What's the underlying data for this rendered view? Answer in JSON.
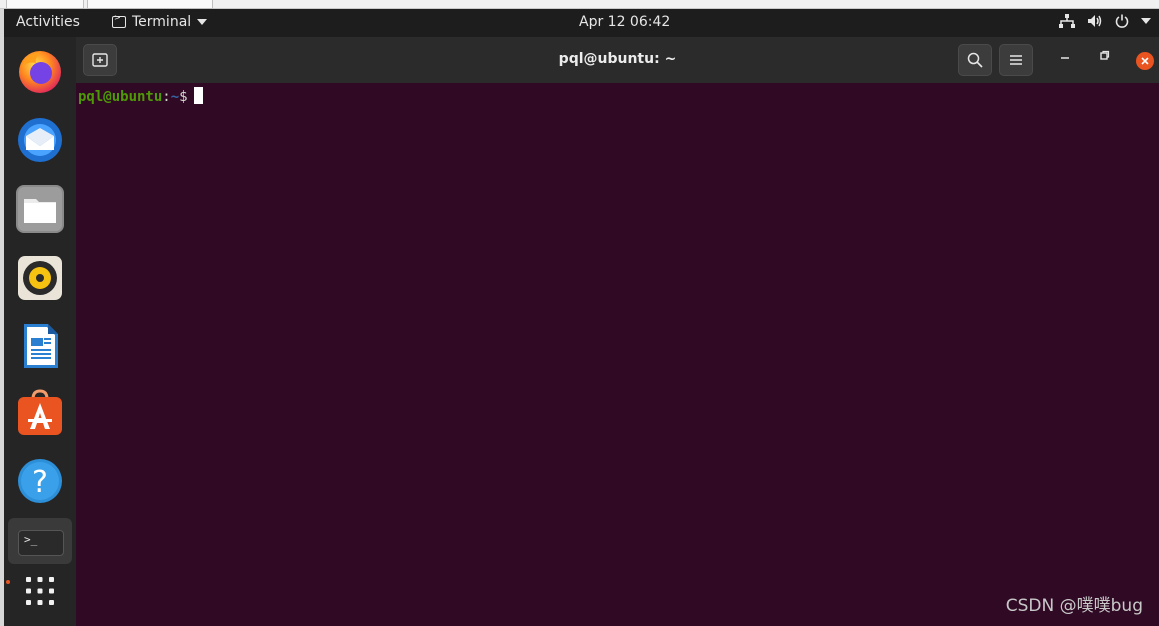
{
  "topbar": {
    "activities": "Activities",
    "app_name": "Terminal",
    "clock": "Apr 12  06:42",
    "tray_icons": [
      "network-icon",
      "volume-icon",
      "power-icon",
      "chevron-down-icon"
    ]
  },
  "dock": {
    "items": [
      "firefox",
      "thunderbird",
      "files",
      "rhythmbox",
      "libreoffice-writer",
      "ubuntu-software",
      "help",
      "terminal",
      "show-applications"
    ],
    "active_item": "terminal",
    "terminal_glyph": ">_"
  },
  "terminal": {
    "title": "pql@ubuntu: ~",
    "prompt_user": "pql@ubuntu",
    "prompt_colon": ":",
    "prompt_path": "~",
    "prompt_dollar": "$",
    "background": "#300a24"
  },
  "watermark": "CSDN @噗噗bug"
}
